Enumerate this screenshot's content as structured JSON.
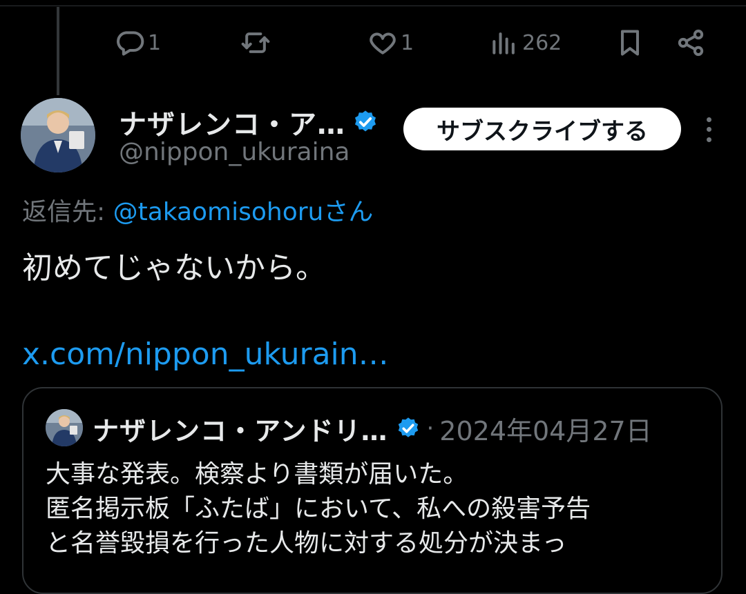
{
  "prev_tweet": {
    "actions": {
      "reply_count": "1",
      "retweet_count": "",
      "like_count": "1",
      "view_count": "262"
    }
  },
  "tweet": {
    "author_name": "ナザレンコ・ア…",
    "author_handle": "@nippon_ukuraina",
    "subscribe_label": "サブスクライブする",
    "reply_to_prefix": "返信先: ",
    "reply_to_mention": "@takaomisohoru",
    "reply_to_suffix": "さん",
    "text": "初めてじゃないから。",
    "link": "x.com/nippon_ukurain…"
  },
  "quote": {
    "author_name": "ナザレンコ・アンドリ…",
    "separator": "·",
    "date": "2024年04月27日",
    "lines": [
      "大事な発表。検察より書類が届いた。",
      "匿名掲示板「ふたば」において、私への殺害予告",
      "と名誉毀損を行った人物に対する処分が決まっ"
    ]
  },
  "colors": {
    "background": "#000000",
    "text": "#e7e9ea",
    "muted": "#71767b",
    "accent": "#1d9bf0",
    "border": "#2f3336"
  },
  "icons": [
    "reply-icon",
    "retweet-icon",
    "like-icon",
    "views-icon",
    "bookmark-icon",
    "share-icon",
    "verified-icon",
    "more-icon"
  ]
}
